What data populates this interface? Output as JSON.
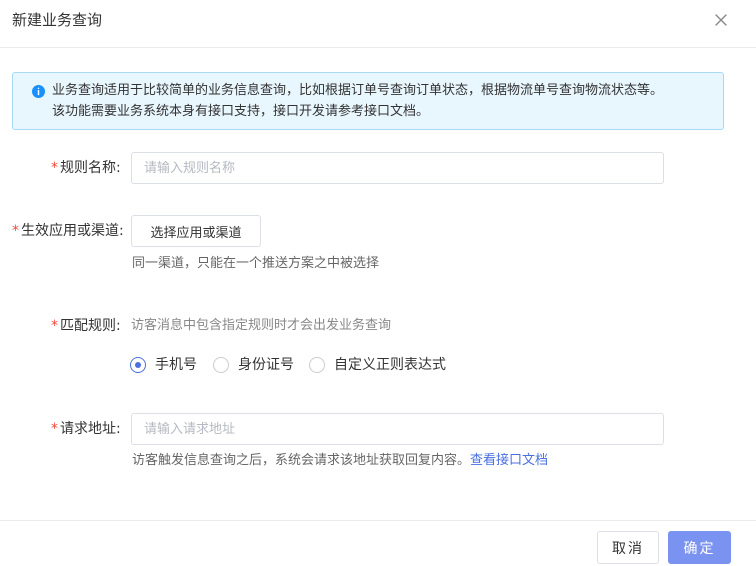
{
  "dialog": {
    "title": "新建业务查询"
  },
  "alert": {
    "line1": "业务查询适用于比较简单的业务信息查询，比如根据订单号查询订单状态，根据物流单号查询物流状态等。",
    "line2": "该功能需要业务系统本身有接口支持，接口开发请参考接口文档。",
    "icon": "info-icon",
    "color": "#1890ff"
  },
  "form": {
    "required_mark": "*",
    "rule_name": {
      "label": "规则名称:",
      "placeholder": "请输入规则名称",
      "value": ""
    },
    "channel": {
      "label": "生效应用或渠道:",
      "button": "选择应用或渠道",
      "hint": "同一渠道，只能在一个推送方案之中被选择"
    },
    "match_rule": {
      "label": "匹配规则:",
      "description": "访客消息中包含指定规则时才会出发业务查询",
      "options": [
        {
          "label": "手机号",
          "checked": true
        },
        {
          "label": "身份证号",
          "checked": false
        },
        {
          "label": "自定义正则表达式",
          "checked": false
        }
      ]
    },
    "request_url": {
      "label": "请求地址:",
      "placeholder": "请输入请求地址",
      "value": "",
      "hint": "访客触发信息查询之后，系统会请求该地址获取回复内容。",
      "link": "查看接口文档"
    }
  },
  "footer": {
    "cancel_label": "取消",
    "ok_label": "确定"
  },
  "colors": {
    "primary": "#7b93f0",
    "link": "#4a6fe3",
    "required": "#f5483b",
    "alert_bg": "#e8f6fe"
  }
}
